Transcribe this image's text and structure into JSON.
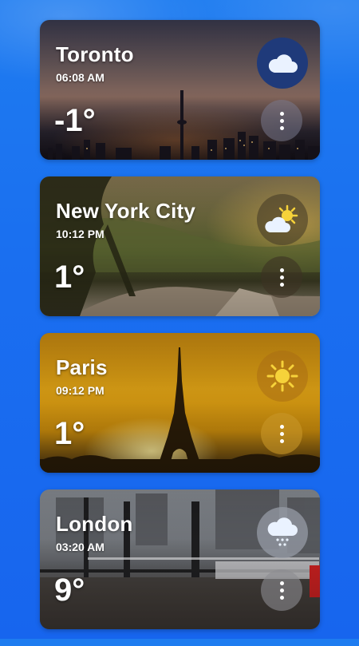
{
  "cities": [
    {
      "name": "Toronto",
      "time": "06:08 AM",
      "temp": "-1°",
      "weather_icon": "cloud-icon"
    },
    {
      "name": "New York City",
      "time": "10:12 PM",
      "temp": "1°",
      "weather_icon": "partly-cloudy-icon"
    },
    {
      "name": "Paris",
      "time": "09:12 PM",
      "temp": "1°",
      "weather_icon": "sun-icon"
    },
    {
      "name": "London",
      "time": "03:20 AM",
      "temp": "9°",
      "weather_icon": "rain-cloud-icon"
    }
  ],
  "colors": {
    "background": "#1a6ff0",
    "sun": "#f6d23a",
    "cloud": "#eaf2ff",
    "text": "#ffffff"
  }
}
